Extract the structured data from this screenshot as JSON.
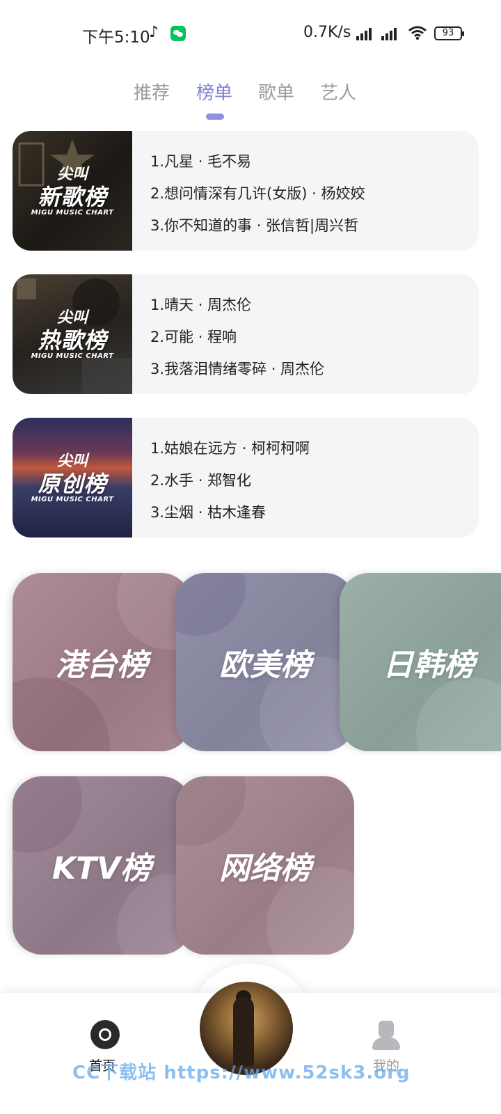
{
  "status_bar": {
    "time": "下午5:10",
    "net_speed": "0.7K/s",
    "battery": "93"
  },
  "tabs": [
    {
      "label": "推荐",
      "active": false
    },
    {
      "label": "榜单",
      "active": true
    },
    {
      "label": "歌单",
      "active": false
    },
    {
      "label": "艺人",
      "active": false
    }
  ],
  "charts": [
    {
      "cover_line1": "尖叫",
      "cover_line2": "新歌榜",
      "cover_sub": "MIGU MUSIC CHART",
      "tracks": [
        "1.凡星 · 毛不易",
        "2.想问情深有几许(女版) · 杨姣姣",
        "3.你不知道的事 · 张信哲|周兴哲"
      ]
    },
    {
      "cover_line1": "尖叫",
      "cover_line2": "热歌榜",
      "cover_sub": "MIGU MUSIC CHART",
      "tracks": [
        "1.晴天 · 周杰伦",
        "2.可能 · 程响",
        "3.我落泪情绪零碎 · 周杰伦"
      ]
    },
    {
      "cover_line1": "尖叫",
      "cover_line2": "原创榜",
      "cover_sub": "MIGU MUSIC CHART",
      "tracks": [
        "1.姑娘在远方 · 柯柯柯啊",
        "2.水手 · 郑智化",
        "3.尘烟 · 枯木逢春"
      ]
    }
  ],
  "categories": [
    {
      "label": "港台榜",
      "color": "#a0808c"
    },
    {
      "label": "欧美榜",
      "color": "#8a88a0"
    },
    {
      "label": "日韩榜",
      "color": "#8fa39c"
    },
    {
      "label": "KTV榜",
      "color": "#95808f"
    },
    {
      "label": "网络榜",
      "color": "#a08489"
    }
  ],
  "bottom_nav": {
    "home_label": "首页",
    "me_label": "我的"
  },
  "watermark": "CC下载站 https://www.52sk3.org"
}
